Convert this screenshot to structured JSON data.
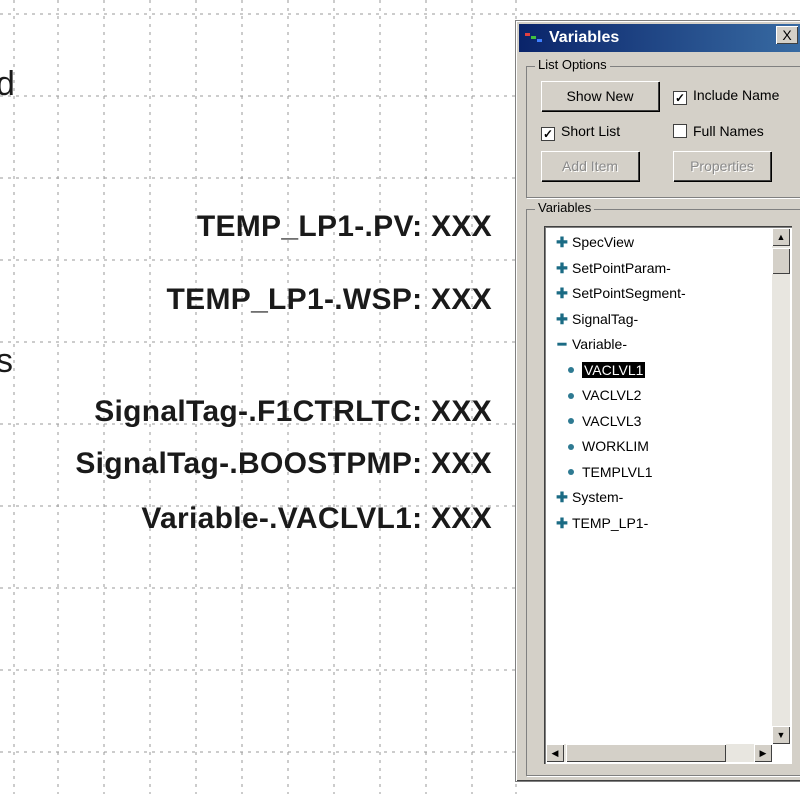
{
  "canvas": {
    "edge_chars": [
      "d",
      "s"
    ],
    "labels": [
      "TEMP_LP1-.PV:  XXX",
      "TEMP_LP1-.WSP:  XXX",
      "SignalTag-.F1CTRLTC:  XXX",
      "SignalTag-.BOOSTPMP:  XXX",
      "Variable-.VACLVL1:  XXX"
    ]
  },
  "window": {
    "title": "Variables",
    "close_glyph": "X",
    "list_options": {
      "group_label": "List Options",
      "show_new_label": "Show New",
      "include_name_label": "Include Name",
      "include_name_checked": true,
      "short_list_label": "Short List",
      "short_list_checked": true,
      "full_names_label": "Full Names",
      "full_names_checked": false,
      "add_item_label": "Add Item",
      "properties_label": "Properties"
    },
    "variables_group_label": "Variables",
    "tree": [
      {
        "label": "SpecView",
        "kind": "expandable"
      },
      {
        "label": "SetPointParam-",
        "kind": "expandable"
      },
      {
        "label": "SetPointSegment-",
        "kind": "expandable"
      },
      {
        "label": "SignalTag-",
        "kind": "expandable"
      },
      {
        "label": "Variable-",
        "kind": "expanded"
      },
      {
        "label": "VACLVL1",
        "kind": "leaf",
        "selected": true
      },
      {
        "label": "VACLVL2",
        "kind": "leaf"
      },
      {
        "label": "VACLVL3",
        "kind": "leaf"
      },
      {
        "label": "WORKLIM",
        "kind": "leaf"
      },
      {
        "label": "TEMPLVL1",
        "kind": "leaf"
      },
      {
        "label": "System-",
        "kind": "expandable"
      },
      {
        "label": "TEMP_LP1-",
        "kind": "expandable"
      }
    ]
  },
  "colors": {
    "title_bar": "#0a246a",
    "window_face": "#d4d0c8",
    "grid_line": "#9a9a9a",
    "tree_icon": "#1b6b84"
  },
  "icons": {
    "expand": "plus-icon",
    "collapse": "minus-icon",
    "leaf": "dot-icon"
  }
}
